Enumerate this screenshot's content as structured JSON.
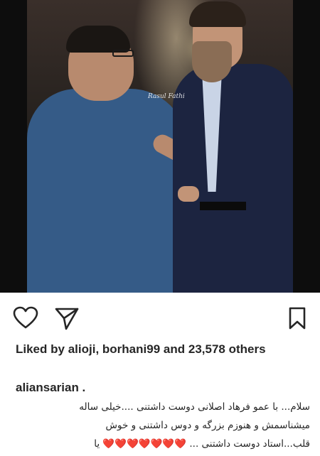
{
  "post": {
    "photo_alt": "",
    "watermark": "Rasul Fathi"
  },
  "actions": {
    "like_icon": "heart-outline-icon",
    "share_icon": "paper-plane-icon",
    "save_icon": "bookmark-icon"
  },
  "likes": {
    "prefix": "Liked by",
    "user1": "alioji",
    "separator": ",",
    "user2": "borhani99",
    "and": "and",
    "count": "23,578",
    "others": "others"
  },
  "author": {
    "username": "aliansarian ."
  },
  "caption": {
    "line1": "سلام... با عمو فرهاد اصلانی دوست داشتنی ....خیلی ساله",
    "line2": "میشناسمش و هنوزم بزرگه و دوس داشتنی و خوش",
    "line3_text": "قلب...استاد دوست داشتنی ...",
    "line3_hearts": "❤️❤️❤️❤️❤️❤️❤️",
    "line3_end": "یا"
  },
  "colors": {
    "text": "#262626",
    "heart": "#e0245e",
    "background": "#ffffff"
  }
}
